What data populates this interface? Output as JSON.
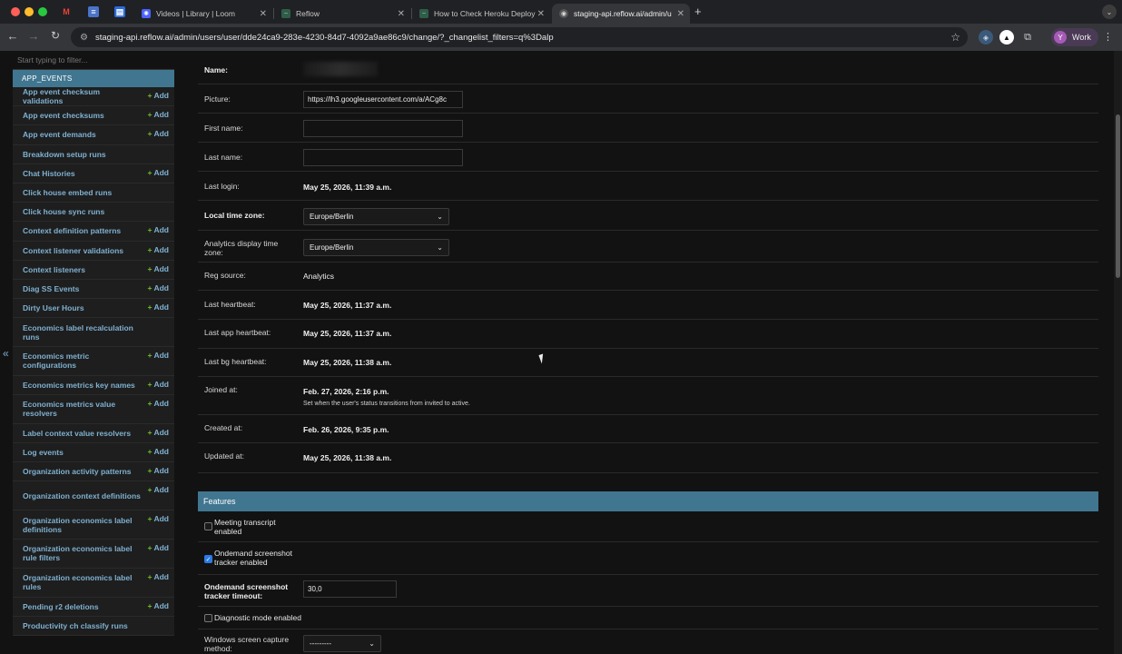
{
  "browser": {
    "tabs": [
      {
        "title": "Videos | Library | Loom"
      },
      {
        "title": "Reflow"
      },
      {
        "title": "How to Check Heroku Deploy"
      },
      {
        "title": "staging-api.reflow.ai/admin/u"
      }
    ],
    "url": "staging-api.reflow.ai/admin/users/user/dde24ca9-283e-4230-84d7-4092a9ae86c9/change/?_changelist_filters=q%3Dalp",
    "profile_initial": "Y",
    "profile_label": "Work"
  },
  "sidebar": {
    "filter_placeholder": "Start typing to filter...",
    "app_name": "APP_EVENTS",
    "add_label": "Add",
    "collapse_glyph": "«",
    "models": [
      {
        "name": "App event checksum validations",
        "add": true
      },
      {
        "name": "App event checksums",
        "add": true
      },
      {
        "name": "App event demands",
        "add": true
      },
      {
        "name": "Breakdown setup runs",
        "add": false
      },
      {
        "name": "Chat Histories",
        "add": true
      },
      {
        "name": "Click house embed runs",
        "add": false
      },
      {
        "name": "Click house sync runs",
        "add": false
      },
      {
        "name": "Context definition patterns",
        "add": true
      },
      {
        "name": "Context listener validations",
        "add": true
      },
      {
        "name": "Context listeners",
        "add": true
      },
      {
        "name": "Diag SS Events",
        "add": true
      },
      {
        "name": "Dirty User Hours",
        "add": true
      },
      {
        "name": "Economics label recalculation runs",
        "add": false
      },
      {
        "name": "Economics metric configurations",
        "add": true
      },
      {
        "name": "Economics metrics key names",
        "add": true
      },
      {
        "name": "Economics metrics value resolvers",
        "add": true
      },
      {
        "name": "Label context value resolvers",
        "add": true
      },
      {
        "name": "Log events",
        "add": true
      },
      {
        "name": "Organization activity patterns",
        "add": true
      },
      {
        "name": "Organization context definitions",
        "add": true
      },
      {
        "name": "Organization economics label definitions",
        "add": true
      },
      {
        "name": "Organization economics label rule filters",
        "add": true
      },
      {
        "name": "Organization economics label rules",
        "add": true
      },
      {
        "name": "Pending r2 deletions",
        "add": true
      },
      {
        "name": "Productivity ch classify runs",
        "add": false
      }
    ]
  },
  "form": {
    "name_label": "Name:",
    "picture_label": "Picture:",
    "picture_value": "https://lh3.googleusercontent.com/a/ACg8c",
    "first_name_label": "First name:",
    "last_name_label": "Last name:",
    "last_login_label": "Last login:",
    "last_login_value": "May 25, 2026, 11:39 a.m.",
    "local_tz_label": "Local time zone:",
    "local_tz_value": "Europe/Berlin",
    "analytics_tz_label": "Analytics display time zone:",
    "analytics_tz_value": "Europe/Berlin",
    "reg_source_label": "Reg source:",
    "reg_source_value": "Analytics",
    "last_heartbeat_label": "Last heartbeat:",
    "last_heartbeat_value": "May 25, 2026, 11:37 a.m.",
    "last_app_heartbeat_label": "Last app heartbeat:",
    "last_app_heartbeat_value": "May 25, 2026, 11:37 a.m.",
    "last_bg_heartbeat_label": "Last bg heartbeat:",
    "last_bg_heartbeat_value": "May 25, 2026, 11:38 a.m.",
    "joined_at_label": "Joined at:",
    "joined_at_value": "Feb. 27, 2026, 2:16 p.m.",
    "joined_at_help": "Set when the user's status transitions from invited to active.",
    "created_at_label": "Created at:",
    "created_at_value": "Feb. 26, 2026, 9:35 p.m.",
    "updated_at_label": "Updated at:",
    "updated_at_value": "May 25, 2026, 11:38 a.m."
  },
  "features": {
    "title": "Features",
    "meeting_transcript_label": "Meeting transcript enabled",
    "meeting_transcript_checked": false,
    "ondemand_label": "Ondemand screenshot tracker enabled",
    "ondemand_checked": true,
    "ondemand_timeout_label": "Ondemand screenshot tracker timeout:",
    "ondemand_timeout_value": "30,0",
    "diagnostic_label": "Diagnostic mode enabled",
    "diagnostic_checked": false,
    "windows_capture_label": "Windows screen capture method:",
    "windows_capture_value": "---------"
  }
}
